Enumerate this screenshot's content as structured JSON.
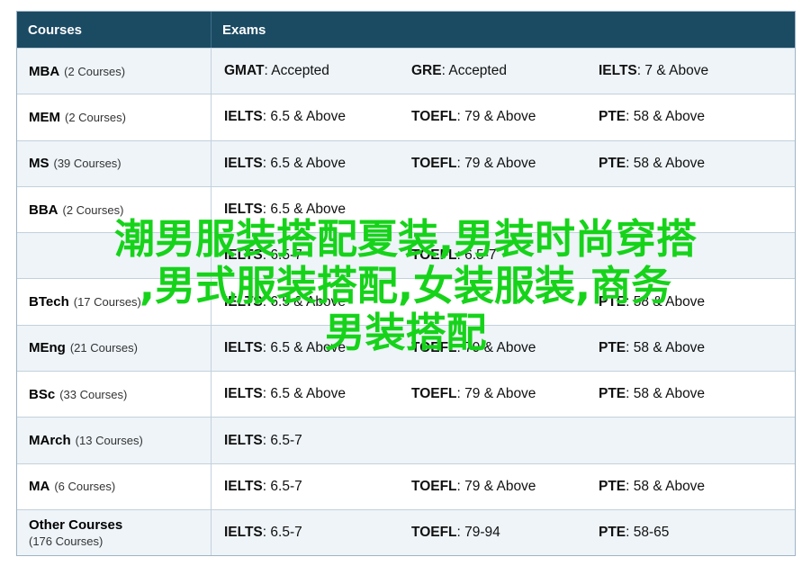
{
  "header": {
    "courses": "Courses",
    "exams": "Exams"
  },
  "rows": [
    {
      "name": "MBA",
      "count": "(2 Courses)",
      "exams": [
        {
          "exam": "GMAT",
          "score": ": Accepted"
        },
        {
          "exam": "GRE",
          "score": ": Accepted"
        },
        {
          "exam": "IELTS",
          "score": ": 7 & Above"
        }
      ]
    },
    {
      "name": "MEM",
      "count": "(2 Courses)",
      "exams": [
        {
          "exam": "IELTS",
          "score": ": 6.5 & Above"
        },
        {
          "exam": "TOEFL",
          "score": ": 79 & Above"
        },
        {
          "exam": "PTE",
          "score": ": 58 & Above"
        }
      ]
    },
    {
      "name": "MS",
      "count": "(39 Courses)",
      "exams": [
        {
          "exam": "IELTS",
          "score": ": 6.5 & Above"
        },
        {
          "exam": "TOEFL",
          "score": ": 79 & Above"
        },
        {
          "exam": "PTE",
          "score": ": 58 & Above"
        }
      ]
    },
    {
      "name": "BBA",
      "count": "(2 Courses)",
      "exams": [
        {
          "exam": "IELTS",
          "score": ": 6.5 & Above"
        }
      ]
    },
    {
      "name": "",
      "count": "",
      "exams": [
        {
          "exam": "IELTS",
          "score": ": 6.5-7"
        },
        {
          "exam": "TOEFL",
          "score": ": 6.5-7"
        }
      ]
    },
    {
      "name": "BTech",
      "count": "(17 Courses)",
      "exams": [
        {
          "exam": "IELTS",
          "score": ": 6.5 & Above"
        },
        {
          "exam": "",
          "score": ""
        },
        {
          "exam": "PTE",
          "score": ": 58 & Above"
        }
      ]
    },
    {
      "name": "MEng",
      "count": "(21 Courses)",
      "exams": [
        {
          "exam": "IELTS",
          "score": ": 6.5 & Above"
        },
        {
          "exam": "TOEFL",
          "score": ": 79 & Above"
        },
        {
          "exam": "PTE",
          "score": ": 58 & Above"
        }
      ]
    },
    {
      "name": "BSc",
      "count": "(33 Courses)",
      "exams": [
        {
          "exam": "IELTS",
          "score": ": 6.5 & Above"
        },
        {
          "exam": "TOEFL",
          "score": ": 79 & Above"
        },
        {
          "exam": "PTE",
          "score": ": 58 & Above"
        }
      ]
    },
    {
      "name": "MArch",
      "count": "(13 Courses)",
      "exams": [
        {
          "exam": "IELTS",
          "score": ": 6.5-7"
        }
      ]
    },
    {
      "name": "MA",
      "count": "(6 Courses)",
      "exams": [
        {
          "exam": "IELTS",
          "score": ": 6.5-7"
        },
        {
          "exam": "TOEFL",
          "score": ": 79 & Above"
        },
        {
          "exam": "PTE",
          "score": ": 58 & Above"
        }
      ]
    },
    {
      "name": "Other Courses",
      "count": "(176 Courses)",
      "exams": [
        {
          "exam": "IELTS",
          "score": ": 6.5-7"
        },
        {
          "exam": "TOEFL",
          "score": ": 79-94"
        },
        {
          "exam": "PTE",
          "score": ": 58-65"
        }
      ]
    }
  ],
  "overlay": {
    "line1": "潮男服装搭配夏装,男装时尚穿搭",
    "line2": ",男式服装搭配,女装服装,商务",
    "line3": "男装搭配"
  }
}
